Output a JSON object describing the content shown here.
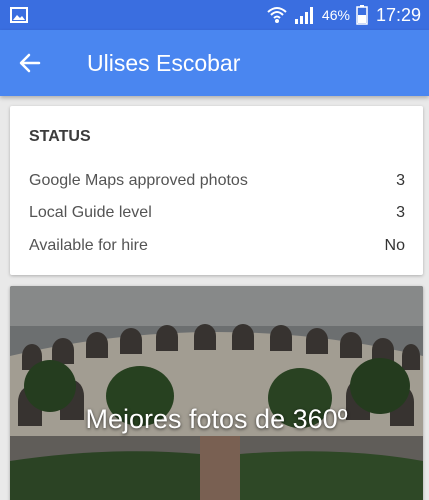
{
  "status_bar": {
    "battery_percent": "46%",
    "time": "17:29",
    "icons": [
      "gallery-icon",
      "wifi-icon",
      "signal-icon",
      "battery-icon"
    ]
  },
  "app_bar": {
    "title": "Ulises Escobar",
    "back_icon": "arrow-back-icon",
    "color": "#4a86f0"
  },
  "status_card": {
    "heading": "STATUS",
    "rows": [
      {
        "label": "Google Maps approved photos",
        "value": "3"
      },
      {
        "label": "Local Guide level",
        "value": "3"
      },
      {
        "label": "Available for hire",
        "value": "No"
      }
    ]
  },
  "photo_card": {
    "caption": "Mejores fotos de 360º"
  }
}
